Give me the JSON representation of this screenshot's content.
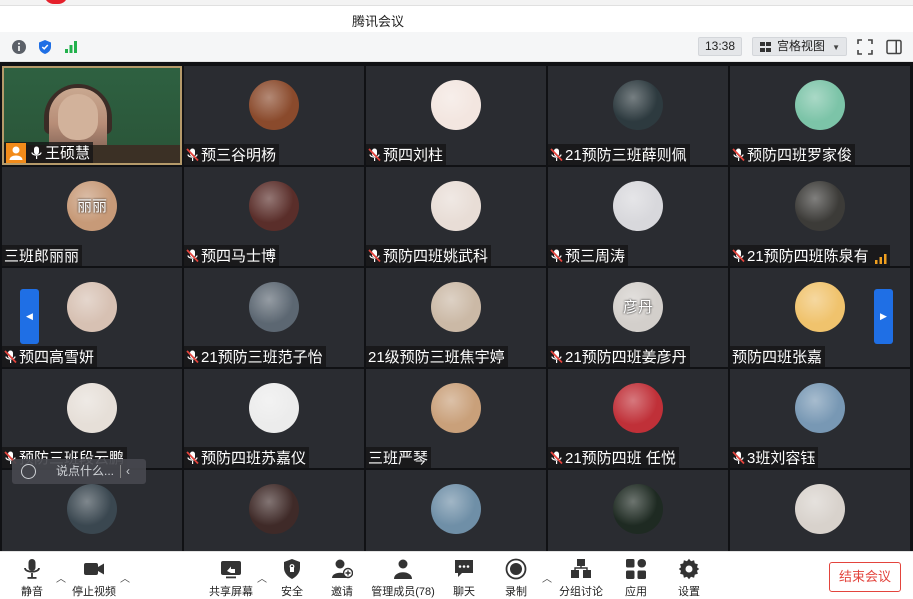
{
  "window": {
    "title": "腾讯会议"
  },
  "infobar": {
    "time": "13:38",
    "view_label": "宫格视图"
  },
  "participants": [
    {
      "name": "王硕慧",
      "muted": false,
      "host": true,
      "avatar": "#2c5a3c"
    },
    {
      "name": "预三谷明杨",
      "muted": true,
      "avatar": "#8a4a2c"
    },
    {
      "name": "预四刘柱",
      "muted": true,
      "avatar": "#f3e6e0"
    },
    {
      "name": "21预防三班薛则佩",
      "muted": true,
      "avatar": "#2d3a3f"
    },
    {
      "name": "预防四班罗家俊",
      "muted": true,
      "avatar": "#7cc4a8"
    },
    {
      "name": "三班郎丽丽",
      "muted": false,
      "avatar": "#c79a78",
      "avatar_text": "丽丽"
    },
    {
      "name": "预四马士博",
      "muted": true,
      "avatar": "#5a2e2a"
    },
    {
      "name": "预防四班姚武科",
      "muted": true,
      "avatar": "#e8ddd6"
    },
    {
      "name": "预三周涛",
      "muted": true,
      "avatar": "#d8d8dc"
    },
    {
      "name": "21预防四班陈泉有",
      "muted": true,
      "avatar": "#3c3b38",
      "signal": true
    },
    {
      "name": "预四高雪妍",
      "muted": true,
      "avatar": "#d7c1b3"
    },
    {
      "name": "21预防三班范子怡",
      "muted": true,
      "avatar": "#5c6772"
    },
    {
      "name": "21级预防三班焦宇婷",
      "muted": false,
      "avatar": "#cbb9a6"
    },
    {
      "name": "21预防四班姜彦丹",
      "muted": true,
      "avatar": "#d3cfcb",
      "avatar_text": "彦丹"
    },
    {
      "name": "预防四班张嘉",
      "muted": false,
      "avatar": "#f0c36d"
    },
    {
      "name": "预防三班段云鹏",
      "muted": true,
      "avatar": "#e6dfd8"
    },
    {
      "name": "预防四班苏嘉仪",
      "muted": true,
      "avatar": "#ececec"
    },
    {
      "name": "三班严琴",
      "muted": false,
      "avatar": "#c9a07a"
    },
    {
      "name": "21预防四班 任悦",
      "muted": true,
      "avatar": "#c03038"
    },
    {
      "name": "3班刘容钰",
      "muted": true,
      "avatar": "#7898b4"
    },
    {
      "name": "",
      "muted": true,
      "avatar": "#3a4750"
    },
    {
      "name": "",
      "muted": true,
      "avatar": "#3f2a28"
    },
    {
      "name": "",
      "muted": false,
      "avatar": "#6f8fa7"
    },
    {
      "name": "",
      "muted": false,
      "avatar": "#1e2a22"
    },
    {
      "name": "",
      "muted": false,
      "avatar": "#d8d2cc"
    }
  ],
  "chat": {
    "placeholder": "说点什么..."
  },
  "toolbar": {
    "mute": "静音",
    "stop_video": "停止视频",
    "share": "共享屏幕",
    "security": "安全",
    "invite": "邀请",
    "members": "管理成员(78)",
    "chat": "聊天",
    "record": "录制",
    "breakout": "分组讨论",
    "apps": "应用",
    "settings": "设置",
    "end": "结束会议"
  },
  "colors": {
    "accent": "#1f6fe5",
    "end": "#e3443d",
    "host_badge": "#f28b1a"
  }
}
